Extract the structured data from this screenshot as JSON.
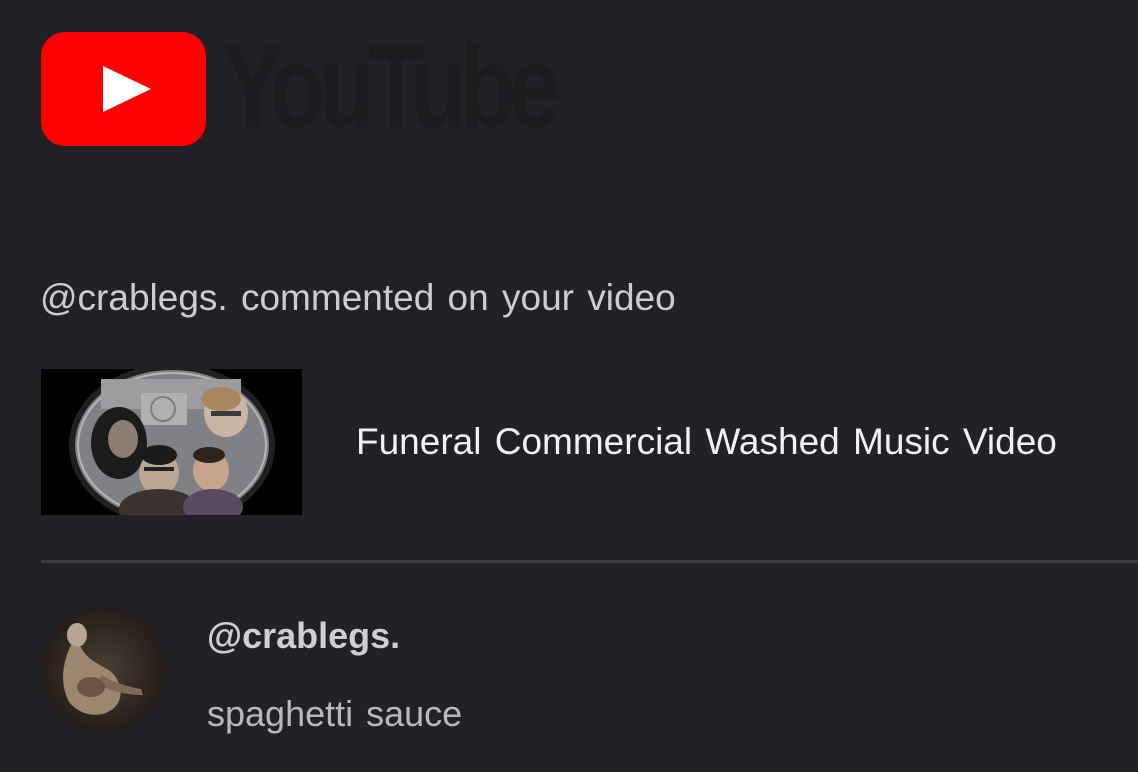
{
  "header": {
    "logo_wordmark": "YouTube",
    "brand_color": "#ff0000"
  },
  "notification": {
    "headline": "@crablegs. commented on your video",
    "video": {
      "title": "Funeral Commercial Washed Music Video"
    },
    "comment": {
      "author": "@crablegs.",
      "text": "spaghetti sauce"
    }
  },
  "icons": {
    "logo": "youtube-play-icon"
  }
}
